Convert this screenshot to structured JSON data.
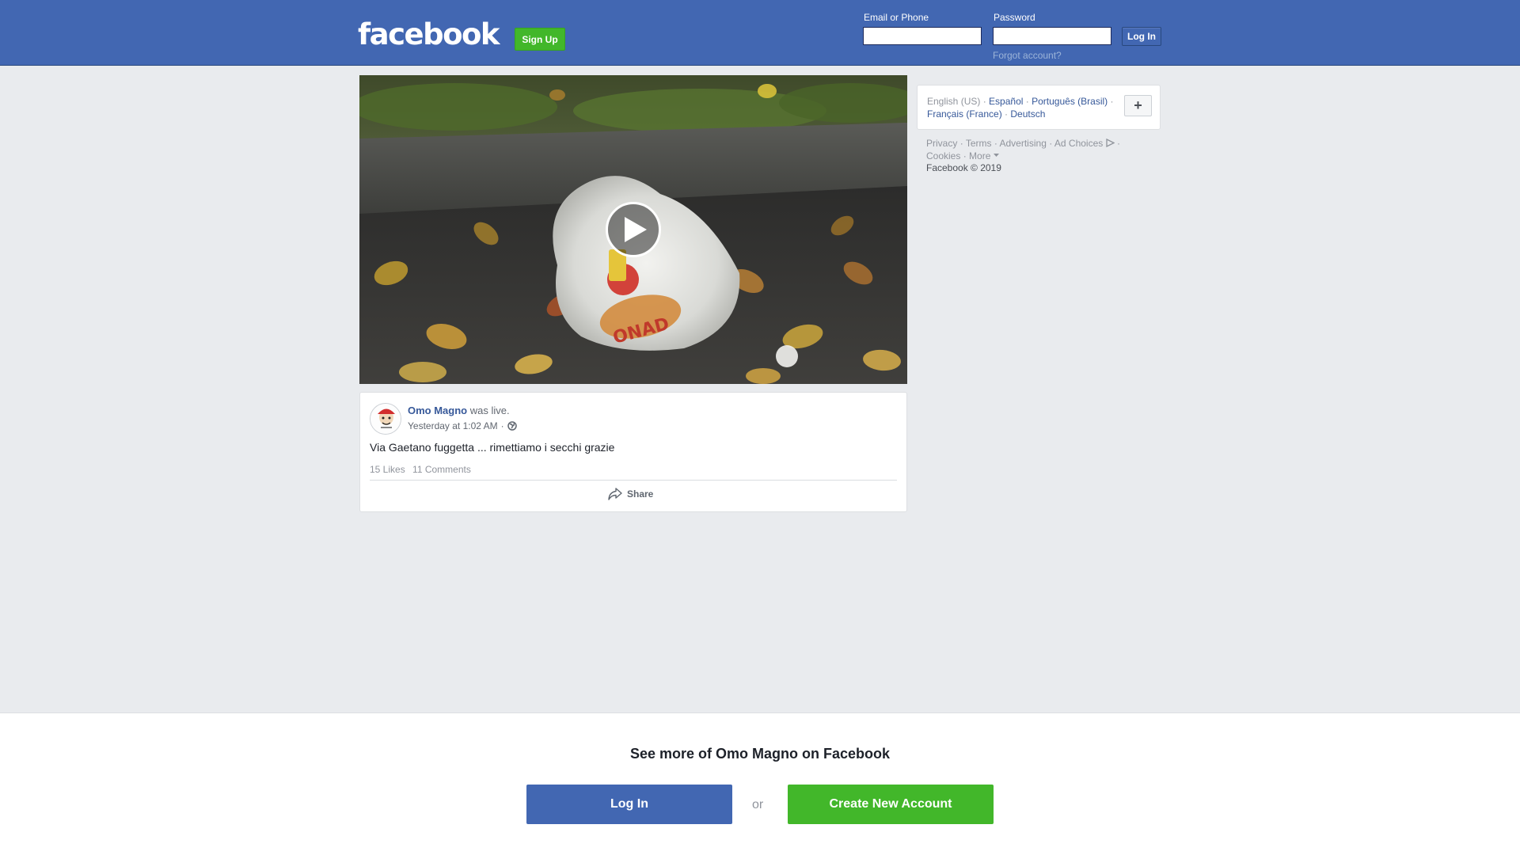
{
  "header": {
    "logo_text": "facebook",
    "signup_label": "Sign Up",
    "email_label": "Email or Phone",
    "password_label": "Password",
    "login_label": "Log In",
    "forgot_label": "Forgot account?"
  },
  "video": {
    "play_icon": "play-icon",
    "bag_text": "ONAD"
  },
  "post": {
    "author": "Omo Magno",
    "action": "was live.",
    "timestamp": "Yesterday at 1:02 AM",
    "separator": "·",
    "privacy_icon": "globe-icon",
    "text": "Via Gaetano fuggetta ... rimettiamo i secchi grazie",
    "likes": "15 Likes",
    "comments": "11 Comments",
    "share_label": "Share"
  },
  "sidebar": {
    "languages": {
      "current": "English (US)",
      "sep": "·",
      "options": [
        "Español",
        "Português (Brasil)",
        "Français (France)",
        "Deutsch"
      ]
    },
    "plus_label": "+",
    "footer_links": [
      "Privacy",
      "Terms",
      "Advertising",
      "Ad Choices",
      "Cookies",
      "More"
    ],
    "copyright": "Facebook © 2019"
  },
  "banner": {
    "title": "See more of Omo Magno on Facebook",
    "login_label": "Log In",
    "or_label": "or",
    "create_label": "Create New Account"
  },
  "colors": {
    "brand_blue": "#4267b2",
    "brand_green": "#42b72a",
    "link_blue": "#365899",
    "page_bg": "#e9ebee"
  }
}
